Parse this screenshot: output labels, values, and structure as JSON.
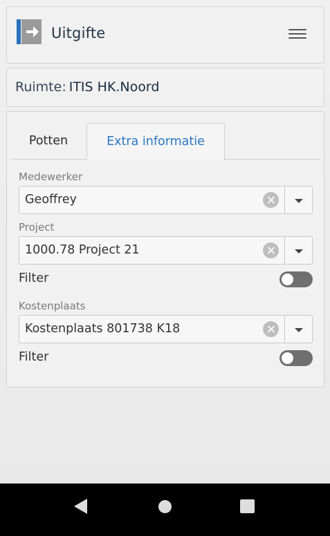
{
  "header": {
    "title": "Uitgifte",
    "logo_icon": "exit-arrow-icon",
    "menu_icon": "hamburger-menu-icon"
  },
  "room": {
    "label": "Ruimte:",
    "value": "ITIS HK.Noord"
  },
  "tabs": [
    {
      "label": "Potten",
      "active": false
    },
    {
      "label": "Extra informatie",
      "active": true
    }
  ],
  "fields": {
    "employee": {
      "label": "Medewerker",
      "value": "Geoffrey"
    },
    "project": {
      "label": "Project",
      "value": "1000.78 Project 21",
      "filter_label": "Filter",
      "filter_on": false
    },
    "cost_center": {
      "label": "Kostenplaats",
      "value": "Kostenplaats 801738 K18",
      "filter_label": "Filter",
      "filter_on": false
    }
  },
  "colors": {
    "accent": "#2a77c4",
    "logo_blue": "#2a6fbd",
    "logo_gray": "#9a9a9a",
    "toggle_off": "#6f6f6f"
  },
  "navbar": {
    "back_icon": "back-triangle-icon",
    "home_icon": "home-circle-icon",
    "recent_icon": "recent-apps-square-icon"
  }
}
